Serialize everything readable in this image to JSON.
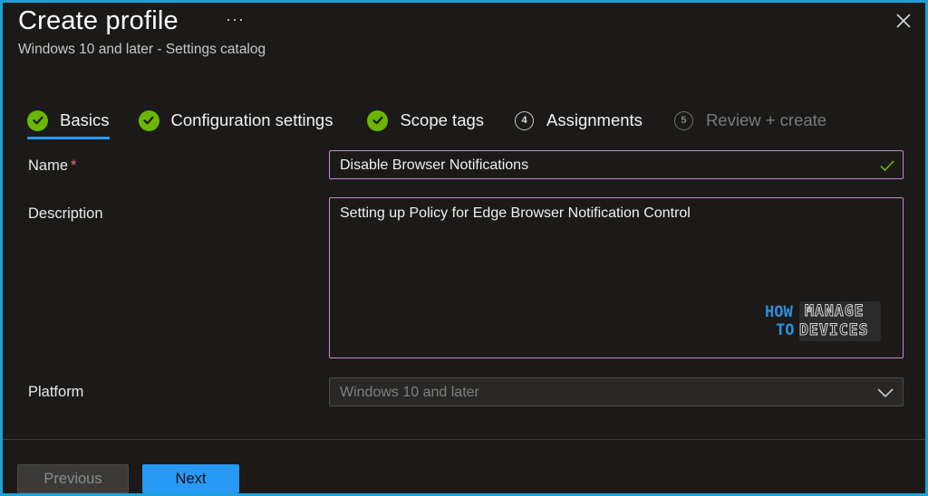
{
  "header": {
    "title": "Create profile",
    "more_label": "···",
    "subtitle": "Windows 10 and later - Settings catalog"
  },
  "steps": [
    {
      "label": "Basics",
      "state": "done",
      "active": true
    },
    {
      "label": "Configuration settings",
      "state": "done",
      "active": false
    },
    {
      "label": "Scope tags",
      "state": "done",
      "active": false
    },
    {
      "label": "Assignments",
      "number": "4",
      "state": "pending",
      "active": false
    },
    {
      "label": "Review + create",
      "number": "5",
      "state": "disabled",
      "active": false
    }
  ],
  "form": {
    "name_label": "Name",
    "required_mark": "*",
    "name_value": "Disable Browser Notifications",
    "description_label": "Description",
    "description_value": "Setting up Policy for Edge Browser Notification Control",
    "platform_label": "Platform",
    "platform_value": "Windows 10 and later"
  },
  "watermark": {
    "how": "HOW",
    "to": "TO",
    "manage": "MANAGE",
    "devices": "DEVICES"
  },
  "footer": {
    "previous_label": "Previous",
    "next_label": "Next"
  },
  "colors": {
    "accent": "#2899f5",
    "success": "#6bb700",
    "focus_border": "#c586d6",
    "background": "#1b1a19",
    "frame": "#1e9fd6"
  }
}
